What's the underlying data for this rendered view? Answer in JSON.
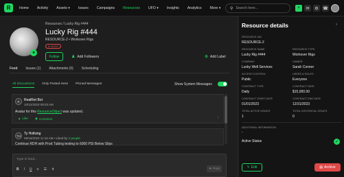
{
  "nav": {
    "logo": "R",
    "items": [
      "Home",
      "Activity",
      "Assets ▾",
      "Issues",
      "Campaigns",
      "Resources",
      "UFO ▾",
      "Insights",
      "Analytics",
      "More ▾"
    ],
    "active_index": 5,
    "search_placeholder": "Search here..."
  },
  "header": {
    "breadcrumb": "Resources  /  Lucky Rig #444",
    "title": "Lucky Rig #444",
    "subtitle": "RESOURCE-2 • Workover Rigs",
    "status": "BUSY",
    "follow_label": "Follow",
    "add_followers_label": "Add Followers",
    "add_label_label": "Add Label"
  },
  "tabs": [
    "Feed",
    "Issues (1)",
    "Attachments (0)",
    "Scheduling"
  ],
  "subtabs": [
    "All Discussions",
    "Only Posted Here",
    "Pinned Messages"
  ],
  "system_messages_label": "Show System Messages",
  "feed": [
    {
      "author": "RealRet Bot",
      "date": "10/12/2023 09:03 AM",
      "text_prefix": "Avatar for this ",
      "link": "ResourceObject",
      "text_suffix": " was updated.",
      "like": "Like",
      "comment": "Comment",
      "avatar": "R"
    },
    {
      "author": "Ty Hollsing",
      "date": "09/16/2023 11:16 AM • Liked by",
      "liked_by": "2 people",
      "text": "Continue RDH with Prod Tubing testing to 6000 PSI Below Slips",
      "avatar": "TH"
    }
  ],
  "composer": {
    "placeholder": "Type in feed...",
    "post_label": "Post",
    "format": [
      "B",
      "I",
      "U",
      "≡",
      "☰",
      "↯"
    ]
  },
  "panel": {
    "title": "Resource details",
    "fields": [
      {
        "label": "Resource UID",
        "value": "RESOURCE-2"
      },
      {
        "label": "Resource Name",
        "value": "Lucky Rig #444"
      },
      {
        "label": "Resource Type",
        "value": "Workover Rigs"
      },
      {
        "label": "Company",
        "value": "Lucky Well Services"
      },
      {
        "label": "Owner",
        "value": "Sarah Connor"
      },
      {
        "label": "Access Control",
        "value": "Public"
      },
      {
        "label": "Users & Roles",
        "value": "Everyone"
      },
      {
        "label": "Contract Type",
        "value": "Daily"
      },
      {
        "label": "Contract Rate",
        "value": "$15,000.00"
      },
      {
        "label": "Contract Start Date",
        "value": "01/01/2023"
      },
      {
        "label": "Contract End Date",
        "value": "12/31/2023"
      },
      {
        "label": "Total Active Issues",
        "value": "1"
      },
      {
        "label": "Total Historical Issues",
        "value": "0"
      },
      {
        "label": "Additional Information",
        "value": "-"
      }
    ],
    "active_status_label": "Active Status",
    "edit_label": "Edit",
    "archive_label": "Archive"
  },
  "colors": {
    "accent": "#1ed760",
    "danger": "#e04848",
    "background": "#1e1e1e",
    "panel": "#141414"
  }
}
